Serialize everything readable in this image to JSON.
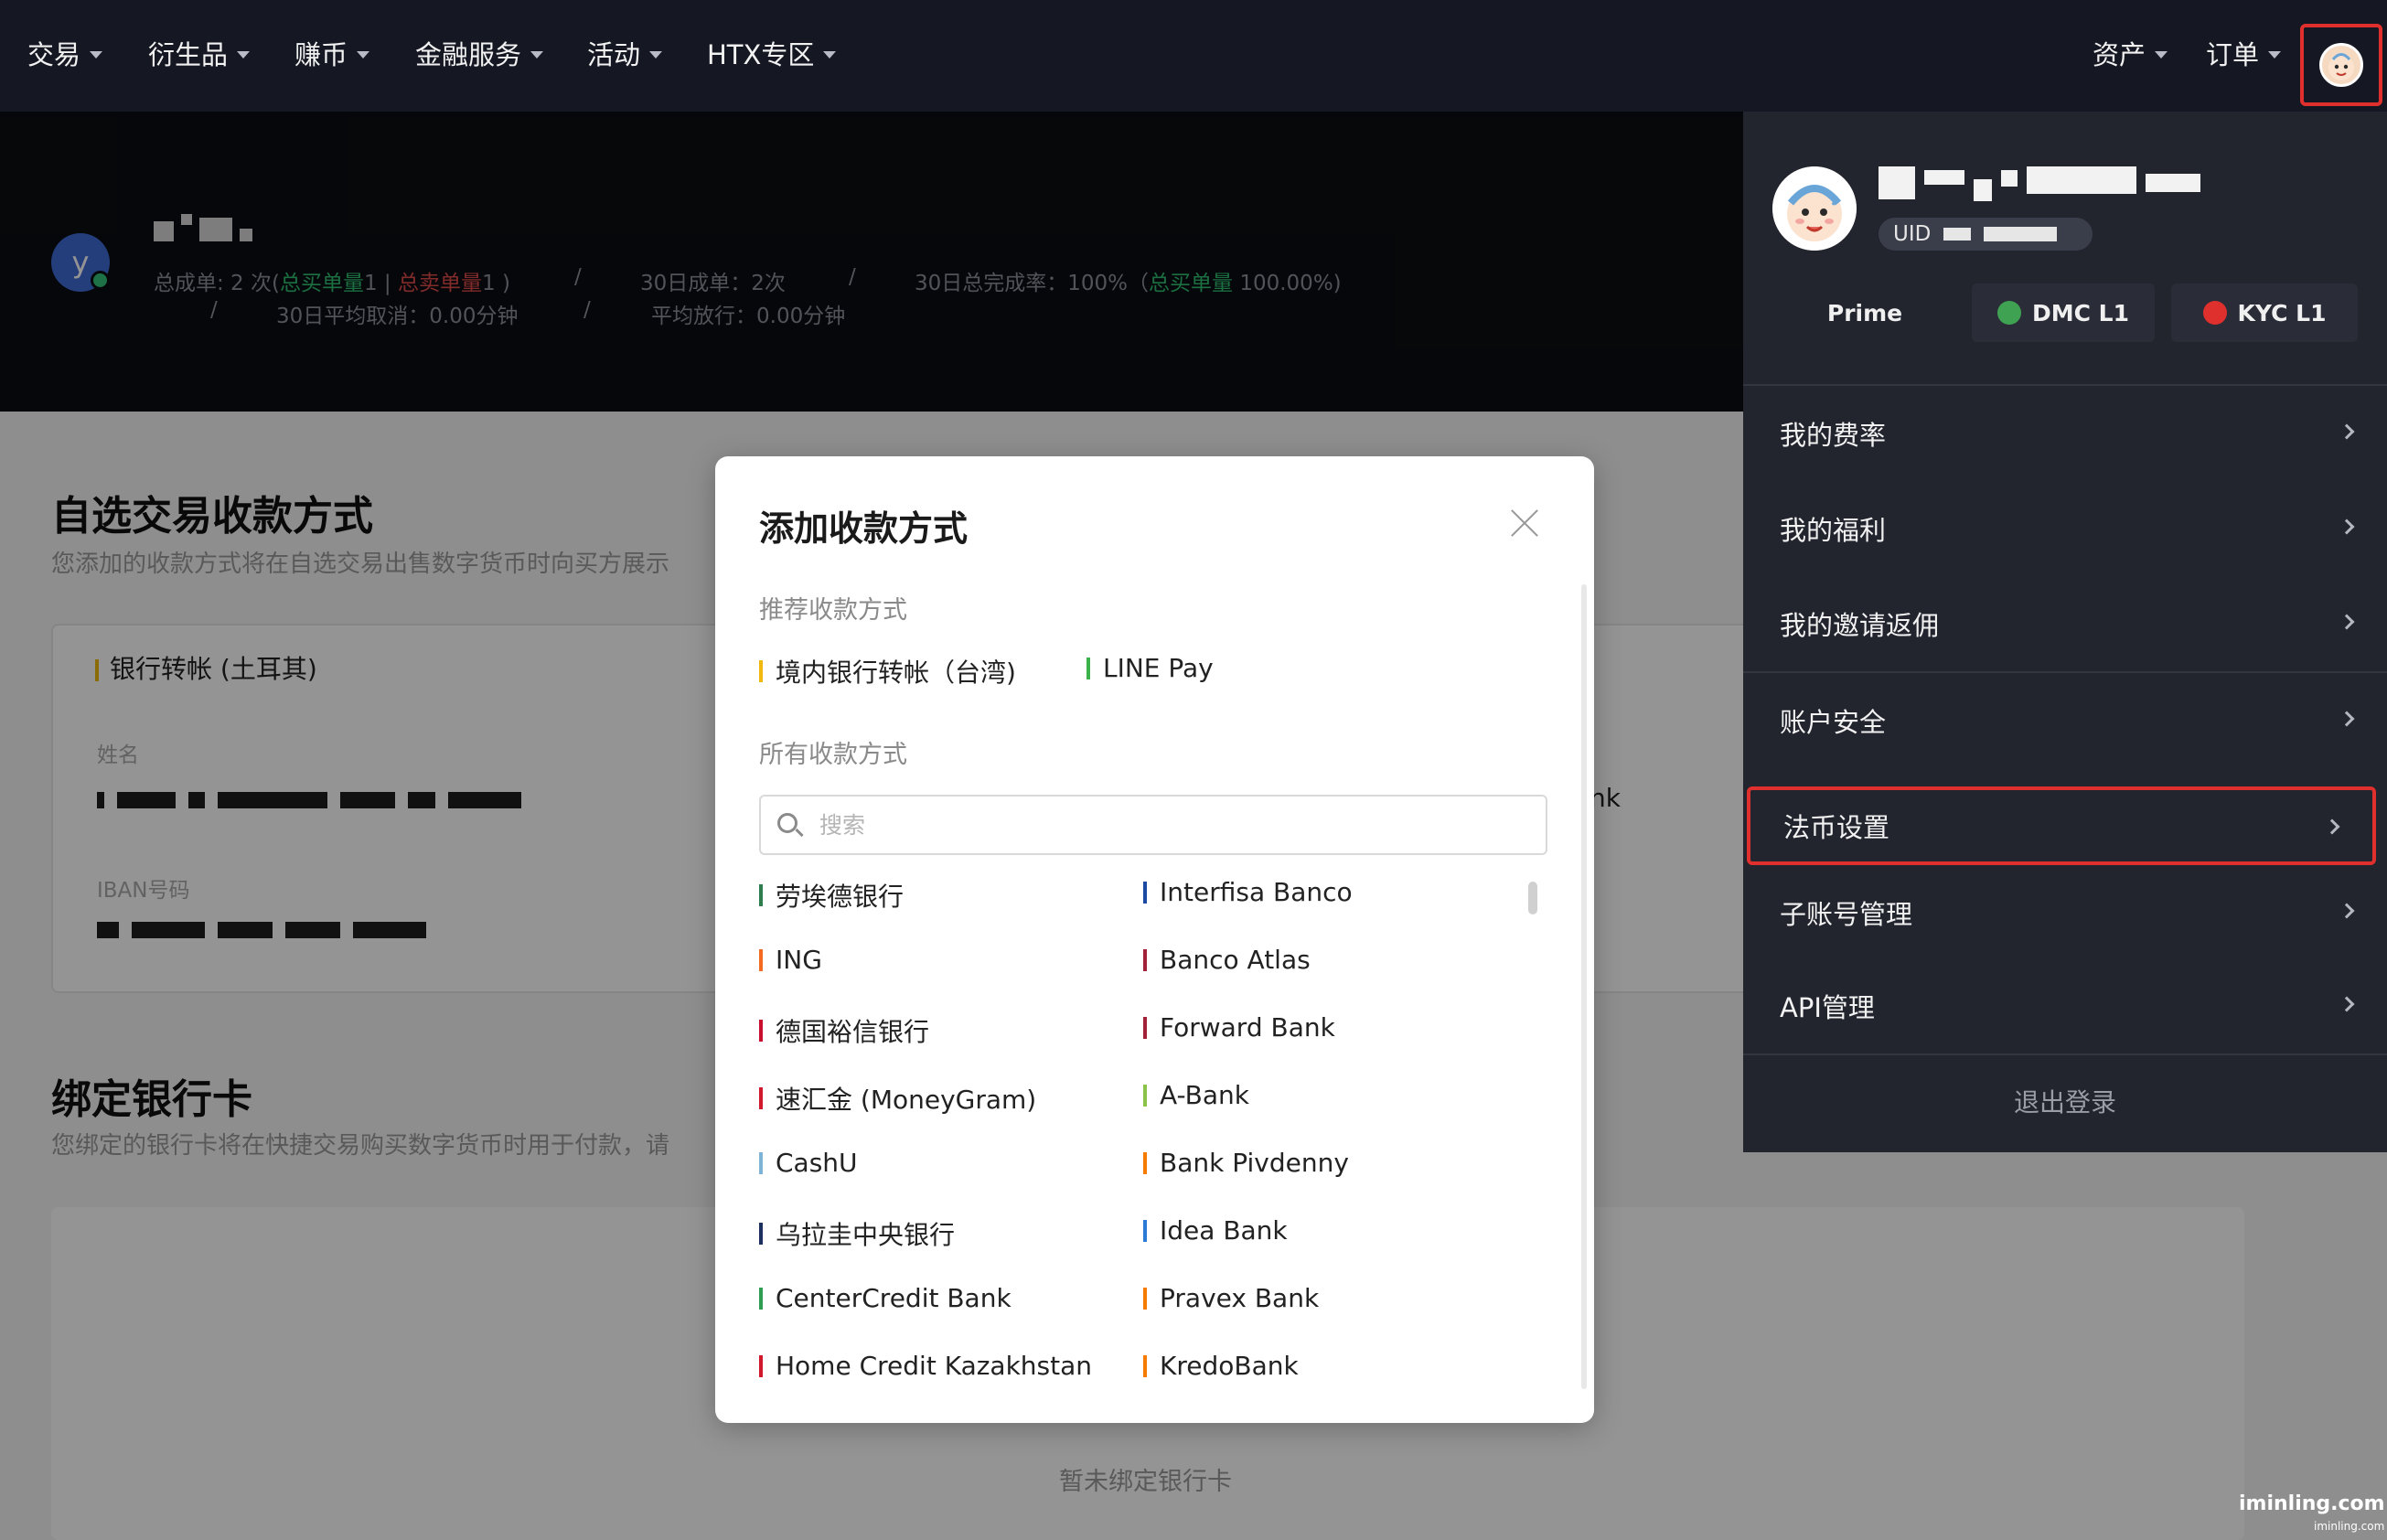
{
  "nav": {
    "items": [
      {
        "label": "交易"
      },
      {
        "label": "衍生品"
      },
      {
        "label": "赚币"
      },
      {
        "label": "金融服务"
      },
      {
        "label": "活动"
      },
      {
        "label": "HTX专区"
      }
    ],
    "right": [
      {
        "label": "资产"
      },
      {
        "label": "订单"
      }
    ]
  },
  "merchant": {
    "avatar_letter": "y",
    "stats_line1": {
      "total_prefix": "总成单: 2 次(",
      "buy_label": "总买单量",
      "buy_count": "1 | ",
      "sell_label": "总卖单量",
      "sell_count": "1 )",
      "sep": "/",
      "orders30": "30日成单：2次",
      "completion_prefix": "30日总完成率：100%（",
      "completion_label": "总买单量",
      "completion_suffix": " 100.00%)"
    },
    "stats_line2": {
      "cancel": "30日平均取消：0.00分钟",
      "release": "平均放行：0.00分钟"
    }
  },
  "page": {
    "section1_title": "自选交易收款方式",
    "section1_sub": "您添加的收款方式将在自选交易出售数字货币时向买方展示",
    "card_title": "银行转帐 (土耳其)",
    "name_label": "姓名",
    "iban_label": "IBAN号码",
    "partial_text": "nk",
    "section2_title": "绑定银行卡",
    "section2_sub": "您绑定的银行卡将在快捷交易购买数字货币时用于付款，请",
    "empty": "暂未绑定银行卡"
  },
  "modal": {
    "title": "添加收款方式",
    "recommended_label": "推荐收款方式",
    "recommended": [
      {
        "label": "境内银行转帐（台湾)",
        "color": "#f0b90b"
      },
      {
        "label": "LINE Pay",
        "color": "#3cb34a"
      }
    ],
    "all_label": "所有收款方式",
    "search_placeholder": "搜索",
    "methods_left": [
      {
        "label": "劳埃德银行",
        "color": "#2e7d4f"
      },
      {
        "label": "ING",
        "color": "#f26b21"
      },
      {
        "label": "德国裕信银行",
        "color": "#c8102e"
      },
      {
        "label": "速汇金 (MoneyGram)",
        "color": "#d0192a"
      },
      {
        "label": "CashU",
        "color": "#7fb3d5"
      },
      {
        "label": "乌拉圭中央银行",
        "color": "#1c2f5e"
      },
      {
        "label": "CenterCredit Bank",
        "color": "#2f9e53"
      },
      {
        "label": "Home Credit Kazakhstan",
        "color": "#d0192a"
      }
    ],
    "methods_right": [
      {
        "label": "Interfisa Banco",
        "color": "#1a4aa1"
      },
      {
        "label": "Banco Atlas",
        "color": "#a3223a"
      },
      {
        "label": "Forward Bank",
        "color": "#a3223a"
      },
      {
        "label": "A-Bank",
        "color": "#8bc34a"
      },
      {
        "label": "Bank Pivdenny",
        "color": "#f57c00"
      },
      {
        "label": "Idea Bank",
        "color": "#2b7bd6"
      },
      {
        "label": "Pravex Bank",
        "color": "#f57c00"
      },
      {
        "label": "KredoBank",
        "color": "#f57c00"
      }
    ]
  },
  "user_menu": {
    "uid_label": "UID",
    "badges": [
      {
        "label": "Prime"
      },
      {
        "label": "DMC L1",
        "dot": "#3fa152"
      },
      {
        "label": "KYC L1",
        "dot": "#e0302e"
      }
    ],
    "items": [
      {
        "label": "我的费率"
      },
      {
        "label": "我的福利"
      },
      {
        "label": "我的邀请返佣"
      },
      {
        "label": "账户安全"
      },
      {
        "label": "法币设置"
      },
      {
        "label": "子账号管理"
      },
      {
        "label": "API管理"
      }
    ],
    "logout": "退出登录"
  },
  "watermark": {
    "text": "iminling.com",
    "small": "iminling.com"
  }
}
